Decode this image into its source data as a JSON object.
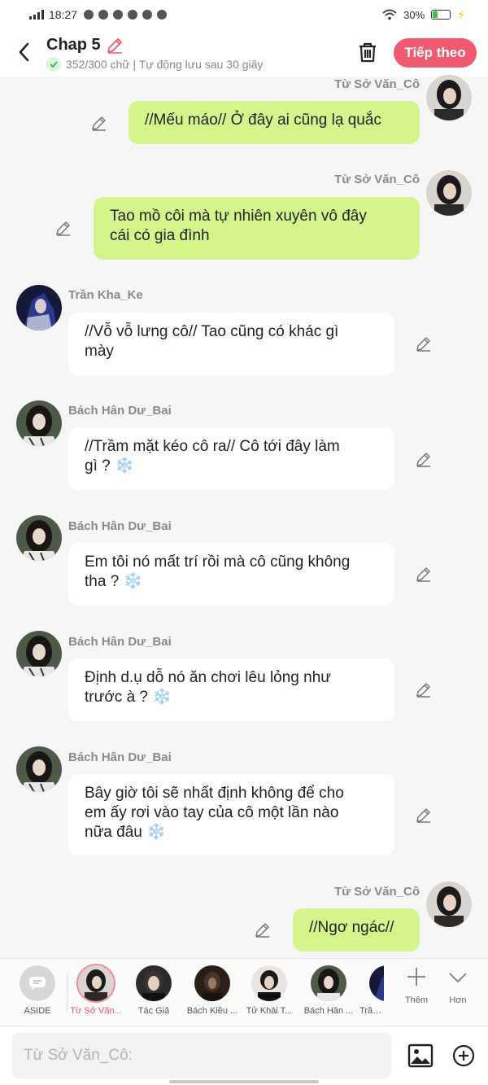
{
  "status": {
    "time": "18:27",
    "battery": "30%",
    "battery_level": 0.3
  },
  "header": {
    "title": "Chap 5",
    "subtitle": "352/300 chữ | Tự động lưu sau 30 giây",
    "next_label": "Tiếp theo"
  },
  "messages": [
    {
      "sender": "Từ Sở Văn_Cô",
      "side": "right",
      "text": "//Mếu máo// Ở đây ai cũng lạ quắc"
    },
    {
      "sender": "Từ Sở Văn_Cô",
      "side": "right",
      "text_lines": [
        "Tao mồ côi mà tự nhiên xuyên vô đây",
        "cái có gia đình"
      ]
    },
    {
      "sender": "Trần Kha_Ke",
      "side": "left",
      "text_lines": [
        "//Vỗ vỗ lưng cô// Tao cũng có khác gì",
        "mày"
      ]
    },
    {
      "sender": "Bách Hân Dư_Bai",
      "side": "left",
      "text_lines": [
        "//Trầm mặt kéo cô ra// Cô tới đây làm",
        "gì ? ❄️"
      ]
    },
    {
      "sender": "Bách Hân Dư_Bai",
      "side": "left",
      "text_lines": [
        "Em tôi nó mất trí rồi mà cô cũng không",
        "tha ? ❄️"
      ]
    },
    {
      "sender": "Bách Hân Dư_Bai",
      "side": "left",
      "text_lines": [
        "Định d.ụ dỗ nó ăn chơi lêu lỏng như",
        "trước à ? ❄️"
      ]
    },
    {
      "sender": "Bách Hân Dư_Bai",
      "side": "left",
      "text_lines": [
        "Bây giờ tôi sẽ nhất định không để cho",
        "em ấy rơi vào tay của cô một lần nào",
        "nữa đâu ❄️"
      ]
    },
    {
      "sender": "Từ Sở Văn_Cô",
      "side": "right",
      "text": "//Ngơ ngác//"
    }
  ],
  "characters": [
    {
      "name": "ASIDE"
    },
    {
      "name": "Từ Sở Văn...",
      "selected": true
    },
    {
      "name": "Tác Giả"
    },
    {
      "name": "Bách Kiều ..."
    },
    {
      "name": "Tử Khải T..."
    },
    {
      "name": "Bách Hân ..."
    },
    {
      "name": "Trần ..."
    }
  ],
  "tools": {
    "add_label": "Thêm",
    "more_label": "Hơn"
  },
  "input": {
    "placeholder": "Từ Sở Văn_Cô:"
  },
  "colors": {
    "accent": "#ef5a6e",
    "my_bubble": "#d4f48c",
    "other_bubble": "#ffffff",
    "background": "#f6f6f6"
  },
  "icons": [
    "back-arrow-icon",
    "pencil-icon",
    "check-icon",
    "trash-icon",
    "image-icon",
    "plus-circle-icon",
    "plus-icon",
    "chevron-down-icon",
    "aside-chat-icon"
  ]
}
